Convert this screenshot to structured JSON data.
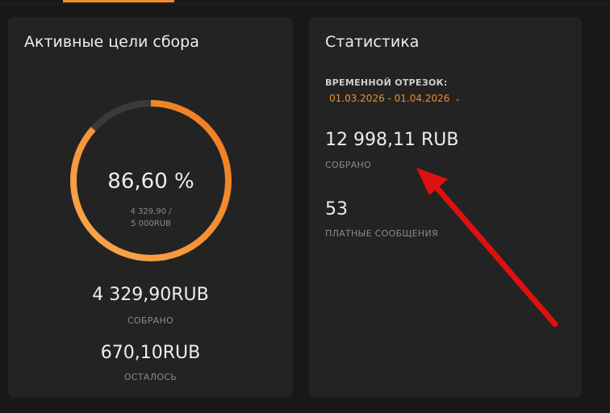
{
  "goals_card": {
    "title": "Активные цели сбора",
    "progress_fraction": 0.866,
    "percent_text": "86,60 %",
    "progress_line1": "4 329,90 /",
    "progress_line2": "5 000RUB",
    "collected_amount": "4 329,90RUB",
    "collected_label": "СОБРАНО",
    "remaining_amount": "670,10RUB",
    "remaining_label": "ОСТАЛОСЬ"
  },
  "stats_card": {
    "title": "Статистика",
    "period_label": "ВРЕМЕННОЙ ОТРЕЗОК:",
    "period_value": "01.03.2026 - 01.04.2026",
    "collected_value": "12 998,11 RUB",
    "collected_label": "СОБРАНО",
    "paid_messages_value": "53",
    "paid_messages_label": "ПЛАТНЫЕ СООБЩЕНИЯ"
  },
  "colors": {
    "accent": "#f28c28",
    "accent_light": "#f7a14a",
    "ring_track": "#3a3a3a",
    "annotation_arrow": "#e01010"
  },
  "icons": {
    "period_dropdown": "chevron-down-icon"
  }
}
